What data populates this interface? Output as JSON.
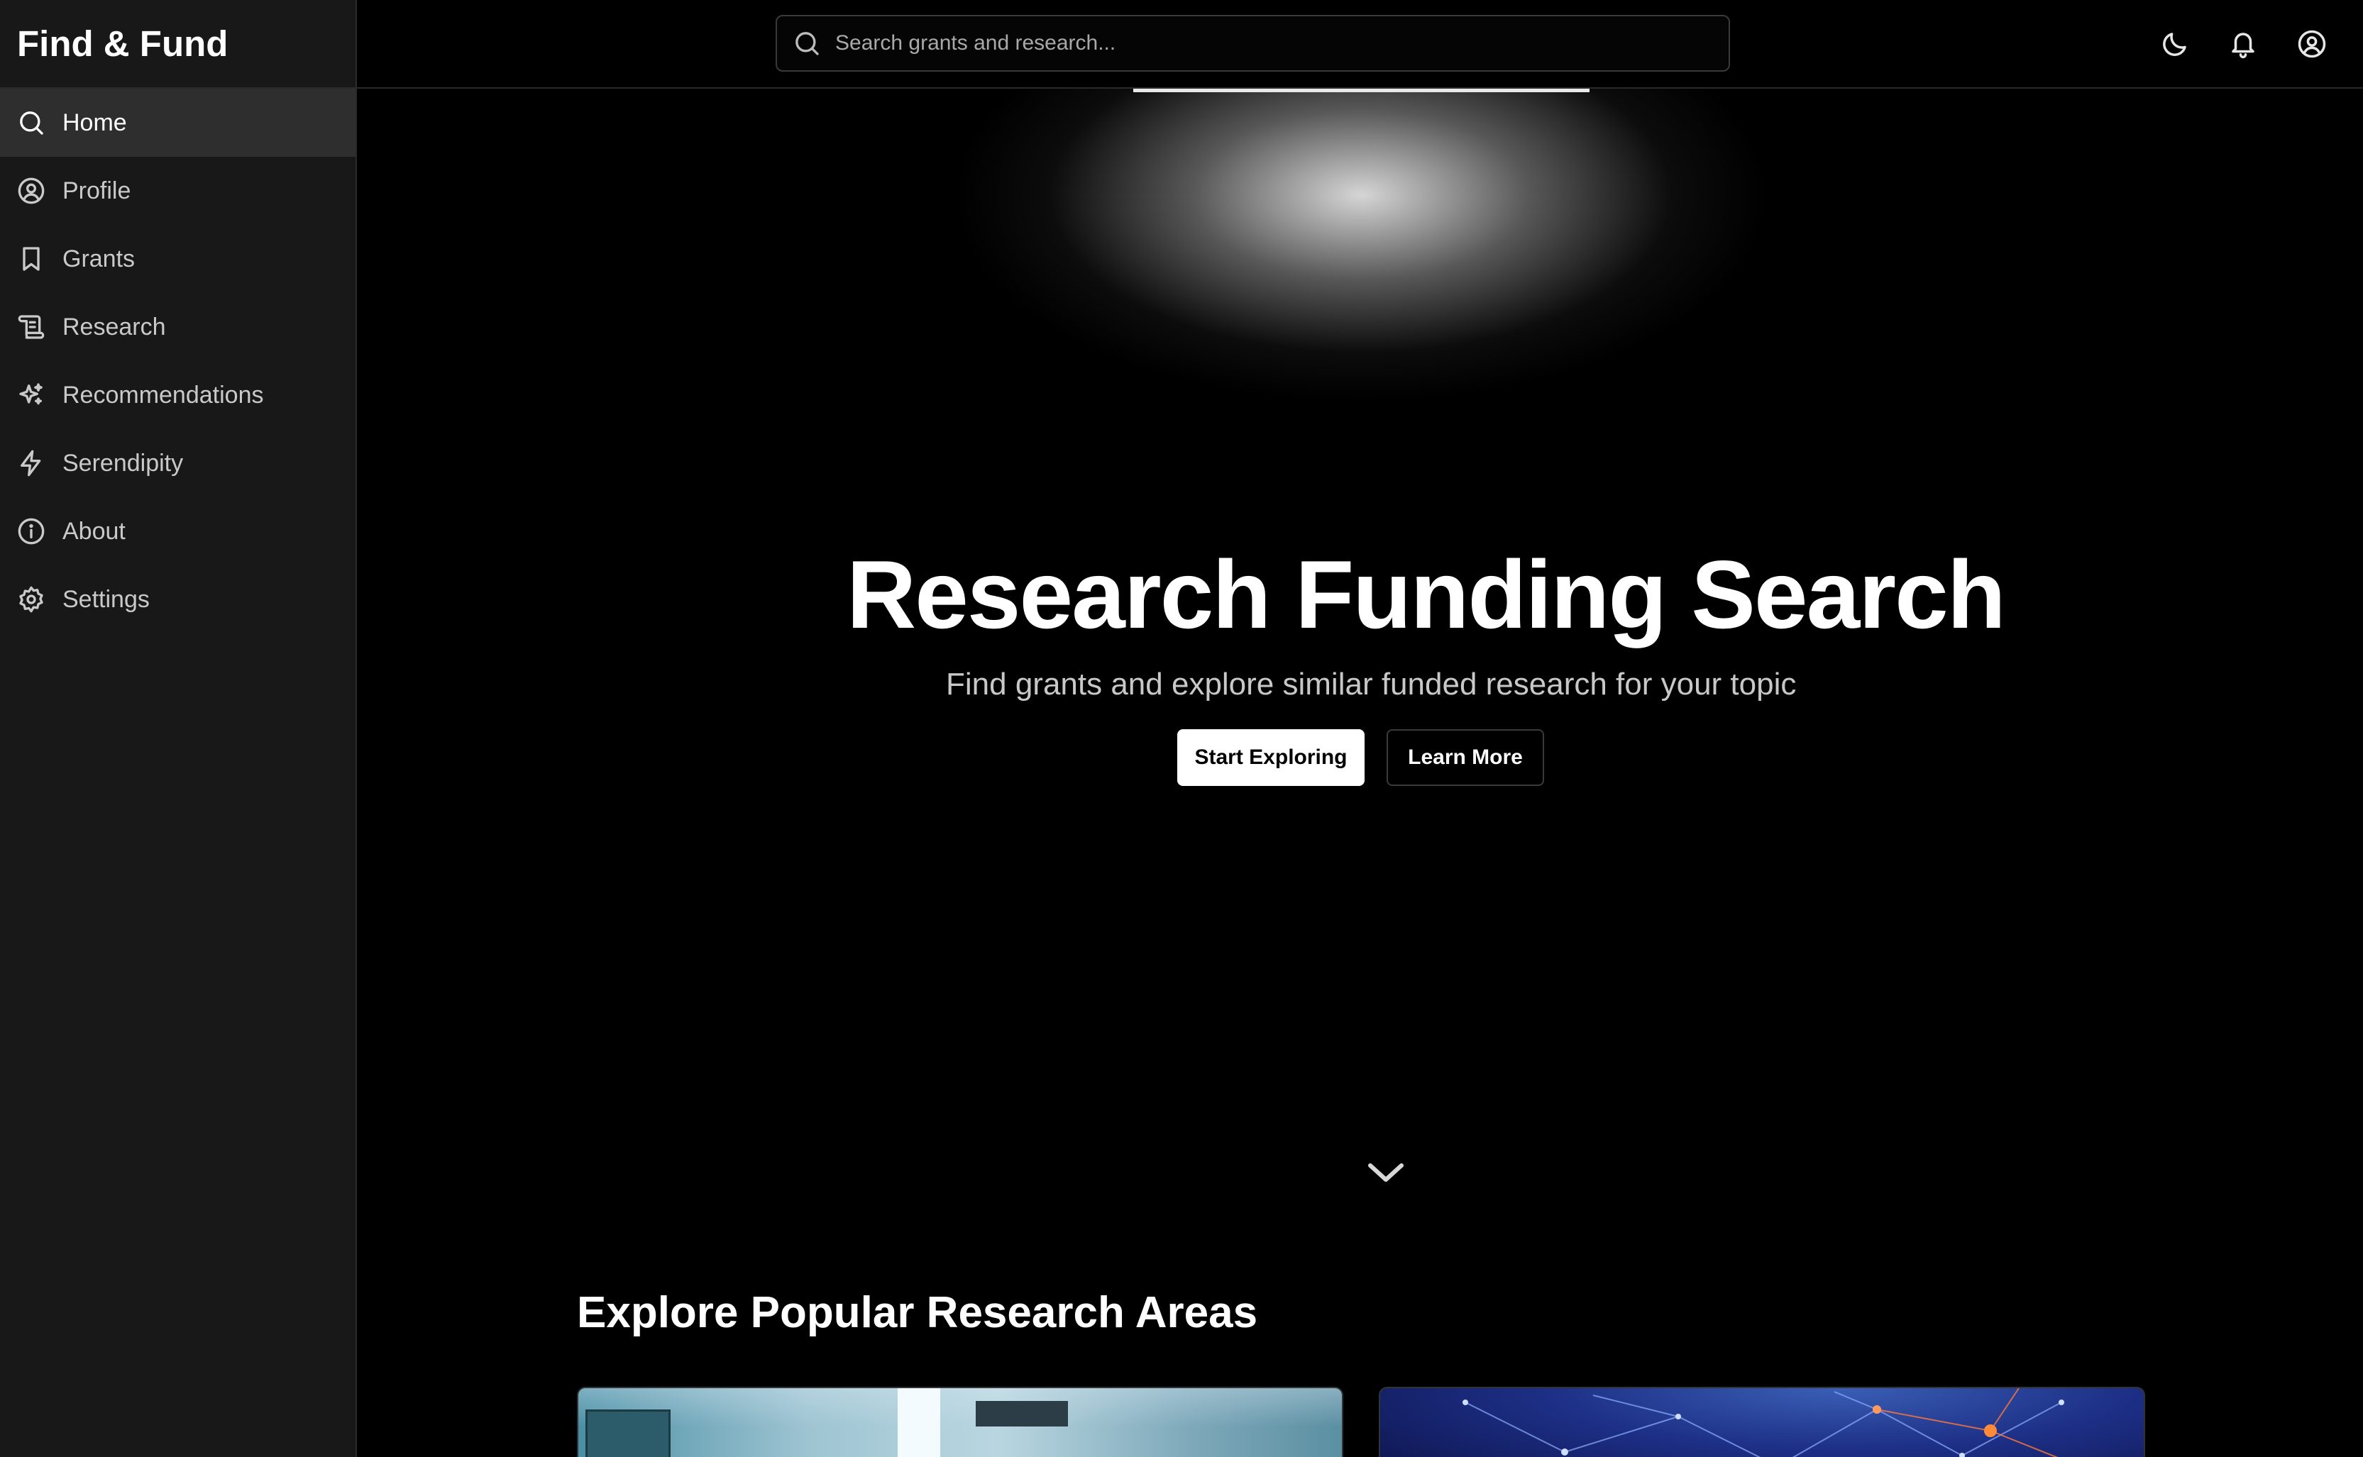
{
  "app": {
    "brand": "Find & Fund"
  },
  "sidebar": {
    "items": [
      {
        "label": "Home",
        "icon": "search-icon",
        "active": true
      },
      {
        "label": "Profile",
        "icon": "user-circle-icon",
        "active": false
      },
      {
        "label": "Grants",
        "icon": "bookmark-icon",
        "active": false
      },
      {
        "label": "Research",
        "icon": "scroll-icon",
        "active": false
      },
      {
        "label": "Recommendations",
        "icon": "sparkles-icon",
        "active": false
      },
      {
        "label": "Serendipity",
        "icon": "lightning-icon",
        "active": false
      },
      {
        "label": "About",
        "icon": "info-icon",
        "active": false
      },
      {
        "label": "Settings",
        "icon": "gear-icon",
        "active": false
      }
    ]
  },
  "header": {
    "search_placeholder": "Search grants and research...",
    "icons": [
      "moon-icon",
      "bell-icon",
      "user-circle-icon"
    ]
  },
  "hero": {
    "title": "Research Funding Search",
    "subtitle": "Find grants and explore similar funded research for your topic",
    "primary_button": "Start Exploring",
    "secondary_button": "Learn More"
  },
  "explore": {
    "title": "Explore Popular Research Areas"
  },
  "colors": {
    "background": "#000000",
    "sidebar": "#181818",
    "active_item": "#2e2e2e",
    "text_primary": "#ffffff",
    "text_secondary": "#c9c9c9"
  }
}
